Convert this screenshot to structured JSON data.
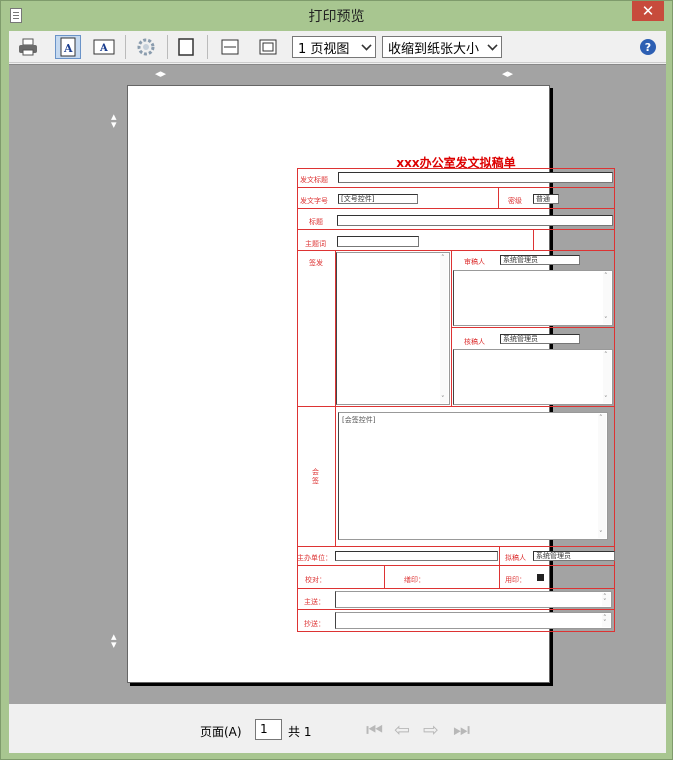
{
  "window": {
    "title": "打印预览",
    "close_label": "✕"
  },
  "toolbar": {
    "view_select": "1 页视图",
    "zoom_select": "收缩到纸张大小",
    "help_label": "?",
    "glyph_a": "A"
  },
  "form": {
    "title": "xxx办公室发文拟稿单",
    "doc_title_label": "发文标题",
    "doc_number_label": "发文字号",
    "doc_number_value": "[文号控件]",
    "priority_label": "密级",
    "priority_value": "普通",
    "subject_label": "标题",
    "keywords_label": "主题词",
    "sign_label": "签发",
    "reviewer_label": "审稿人",
    "reviewer_value": "系统管理员",
    "checker_label": "核稿人",
    "checker_value": "系统管理员",
    "countersign_label": "会签",
    "countersign_value": "[会签控件]",
    "host_unit_label": "主办单位：",
    "drafter_label": "拟稿人",
    "drafter_value": "系统管理员",
    "proofread_label": "校对：",
    "print_label": "缮印：",
    "seal_label": "用印：",
    "main_send_label": "主送：",
    "copy_send_label": "抄送："
  },
  "footer": {
    "page_label": "页面(A)",
    "page_value": "1",
    "total_label": "共 1"
  }
}
